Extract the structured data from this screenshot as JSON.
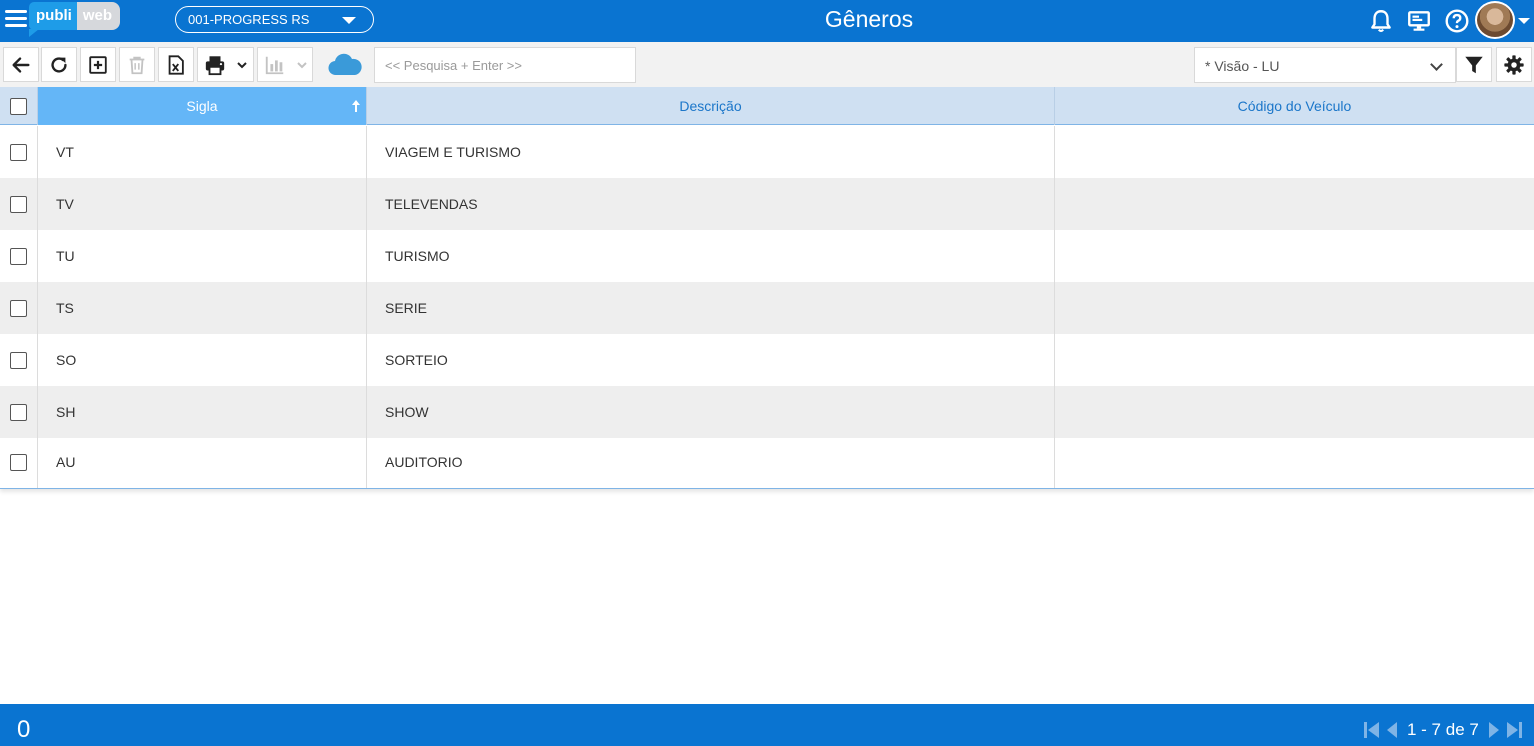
{
  "header": {
    "logo_left": "publi",
    "logo_right": "web",
    "company": "001-PROGRESS RS",
    "title": "Gêneros"
  },
  "toolbar": {
    "search_placeholder": "<< Pesquisa + Enter >>",
    "view_selected": "* Visão - LU"
  },
  "table": {
    "columns": [
      "Sigla",
      "Descrição",
      "Código do Veículo"
    ],
    "sorted_column": "Sigla",
    "sort_direction": "ascending",
    "rows": [
      {
        "sigla": "VT",
        "descricao": "VIAGEM E TURISMO",
        "codigo": ""
      },
      {
        "sigla": "TV",
        "descricao": "TELEVENDAS",
        "codigo": ""
      },
      {
        "sigla": "TU",
        "descricao": "TURISMO",
        "codigo": ""
      },
      {
        "sigla": "TS",
        "descricao": "SERIE",
        "codigo": ""
      },
      {
        "sigla": "SO",
        "descricao": "SORTEIO",
        "codigo": ""
      },
      {
        "sigla": "SH",
        "descricao": "SHOW",
        "codigo": ""
      },
      {
        "sigla": "AU",
        "descricao": "AUDITORIO",
        "codigo": ""
      }
    ]
  },
  "footer": {
    "selected_count": "0",
    "pagination": "1 - 7 de 7"
  },
  "colors": {
    "primary": "#0a74d1",
    "header_row": "#cfe0f2",
    "sorted_header": "#64b6f7",
    "alt_row": "#eeeeee",
    "logo_blue": "#1e9ce8",
    "cloud": "#3a9ad9"
  },
  "icons": [
    "menu-icon",
    "chevron-down-icon",
    "bell-icon",
    "monitor-icon",
    "help-icon",
    "back-arrow-icon",
    "refresh-icon",
    "add-icon",
    "trash-icon",
    "excel-export-icon",
    "print-icon",
    "chart-icon",
    "cloud-icon",
    "filter-icon",
    "gear-icon",
    "sort-ascending-icon",
    "first-page-icon",
    "previous-page-icon",
    "next-page-icon",
    "last-page-icon"
  ]
}
